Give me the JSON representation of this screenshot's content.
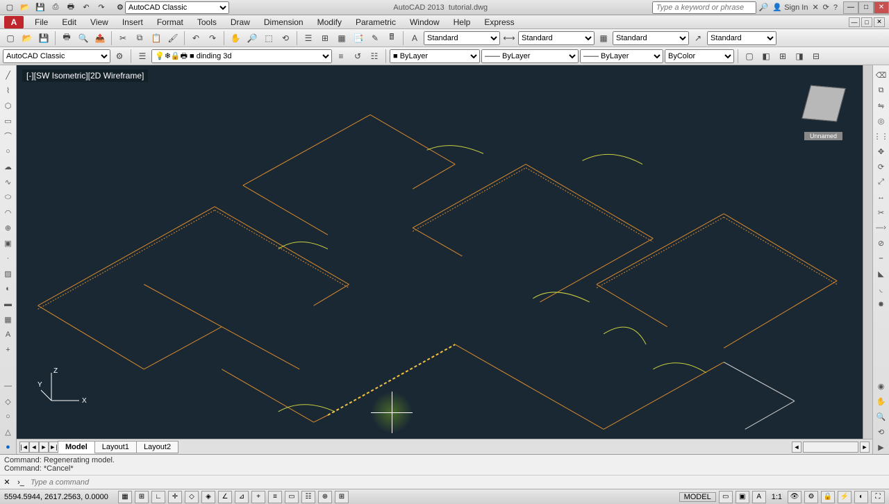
{
  "title": {
    "app": "AutoCAD 2013",
    "file": "tutorial.dwg"
  },
  "workspace_dropdown": "AutoCAD Classic",
  "search_placeholder": "Type a keyword or phrase",
  "signin": "Sign In",
  "menu": [
    "File",
    "Edit",
    "View",
    "Insert",
    "Format",
    "Tools",
    "Draw",
    "Dimension",
    "Modify",
    "Parametric",
    "Window",
    "Help",
    "Express"
  ],
  "workspace2": "AutoCAD Classic",
  "styles": {
    "text": "Standard",
    "dim": "Standard",
    "table": "Standard",
    "mleader": "Standard"
  },
  "layer_current": "dinding 3d",
  "props": {
    "color": "ByLayer",
    "ltype": "ByLayer",
    "lweight": "ByLayer",
    "plot": "ByColor"
  },
  "viewport_label": "[-][SW Isometric][2D Wireframe]",
  "navcube_label": "Unnamed",
  "tabs": {
    "nav": [
      "|◄",
      "◄",
      "►",
      "►|"
    ],
    "items": [
      "Model",
      "Layout1",
      "Layout2"
    ],
    "active": 0
  },
  "cmd_history": [
    "Command:  Regenerating model.",
    "Command: *Cancel*"
  ],
  "cmd_placeholder": "Type a command",
  "status": {
    "coords": "5594.5944, 2617.2563, 0.0000",
    "scale": "1:1",
    "model": "MODEL"
  },
  "ucs": {
    "x": "X",
    "y": "Y",
    "z": "Z"
  }
}
